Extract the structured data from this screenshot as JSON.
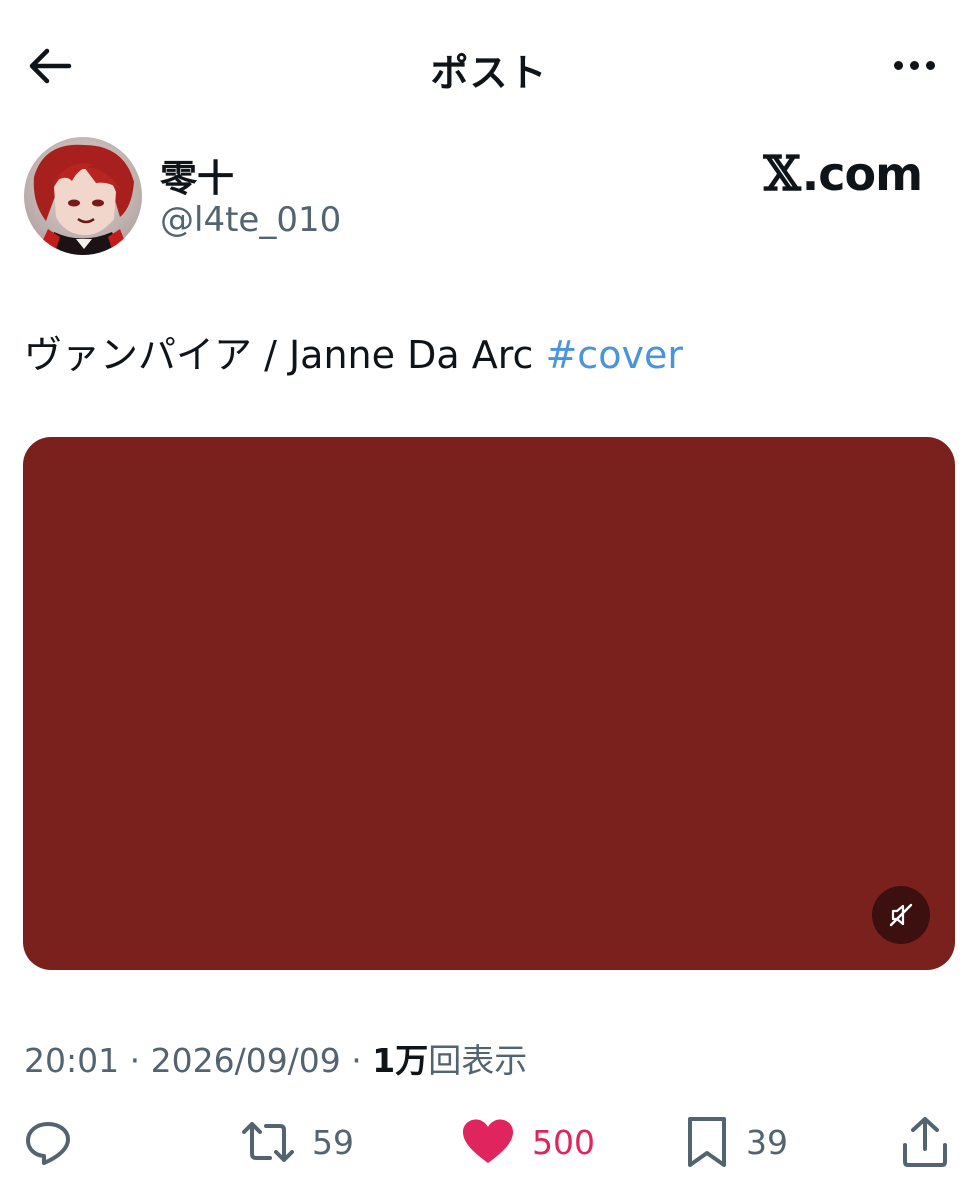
{
  "header": {
    "title": "ポスト",
    "back_icon": "arrow-left-icon",
    "more_icon": "more-horizontal-icon"
  },
  "author": {
    "display_name": "零十",
    "handle": "@l4te_010"
  },
  "watermark": {
    "x_glyph": "𝕏",
    "domain": ".com"
  },
  "post": {
    "text": "ヴァンパイア / Janne Da Arc ",
    "hashtag": "#cover"
  },
  "media": {
    "background_color": "#7a211e",
    "mute_icon": "speaker-muted-icon"
  },
  "meta": {
    "time": "20:01",
    "separator1": " · ",
    "date": "2026/09/09",
    "separator2": " · ",
    "views_count": "1万",
    "views_label": "回表示"
  },
  "actions": {
    "reply": {
      "icon": "reply-icon",
      "count": ""
    },
    "retweet": {
      "icon": "retweet-icon",
      "count": "59"
    },
    "like": {
      "icon": "heart-icon",
      "count": "500",
      "active": true,
      "color": "#e0245e"
    },
    "bookmark": {
      "icon": "bookmark-icon",
      "count": "39"
    },
    "share": {
      "icon": "share-icon",
      "count": ""
    }
  }
}
